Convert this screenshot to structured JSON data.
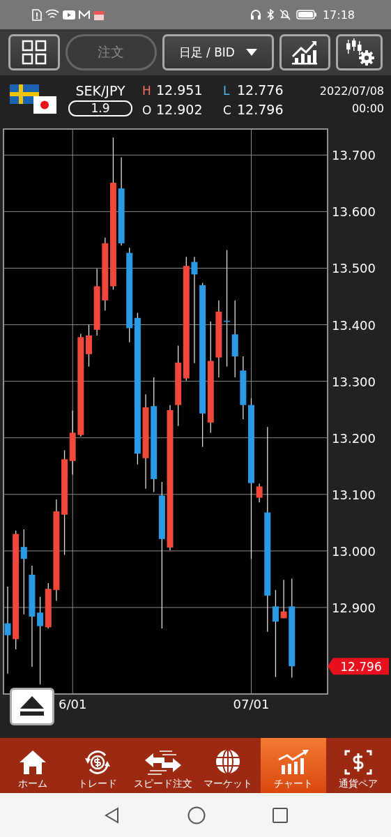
{
  "status_bar": {
    "time": "17:18"
  },
  "toolbar": {
    "order_button": {
      "label": "注文",
      "disabled": true
    },
    "timeframe": {
      "label": "日足 / BID"
    }
  },
  "quote": {
    "pair": "SEK/JPY",
    "spread": "1.9",
    "high_label": "H",
    "high": "12.951",
    "low_label": "L",
    "low": "12.776",
    "open_label": "O",
    "open": "12.902",
    "close_label": "C",
    "close": "12.796",
    "date": "2022/07/08",
    "time": "00:00"
  },
  "chart": {
    "last_price": "12.796",
    "chart_data": {
      "type": "candlestick",
      "grid": true,
      "ylim": [
        12.747,
        13.746
      ],
      "yticks": [
        {
          "value": 12.9,
          "label": "12.900"
        },
        {
          "value": 13.0,
          "label": "13.000"
        },
        {
          "value": 13.1,
          "label": "13.100"
        },
        {
          "value": 13.2,
          "label": "13.200"
        },
        {
          "value": 13.3,
          "label": "13.300"
        },
        {
          "value": 13.4,
          "label": "13.400"
        },
        {
          "value": 13.5,
          "label": "13.500"
        },
        {
          "value": 13.6,
          "label": "13.600"
        },
        {
          "value": 13.7,
          "label": "13.700"
        }
      ],
      "categories": [
        null,
        null,
        null,
        null,
        null,
        null,
        null,
        null,
        "6/01",
        null,
        null,
        null,
        null,
        null,
        null,
        null,
        null,
        null,
        null,
        null,
        null,
        null,
        null,
        null,
        null,
        null,
        null,
        null,
        null,
        null,
        "07/01",
        null,
        null,
        null,
        null,
        null
      ],
      "ohlc": [
        [
          12.872,
          12.937,
          12.783,
          12.851
        ],
        [
          12.844,
          13.036,
          12.826,
          13.03
        ],
        [
          13.007,
          13.038,
          12.888,
          12.986
        ],
        [
          12.958,
          12.974,
          12.795,
          12.884
        ],
        [
          12.891,
          12.919,
          12.764,
          12.867
        ],
        [
          12.865,
          12.943,
          12.863,
          12.933
        ],
        [
          12.931,
          13.091,
          12.912,
          13.07
        ],
        [
          13.064,
          13.178,
          12.993,
          13.162
        ],
        [
          13.159,
          13.248,
          13.135,
          13.209
        ],
        [
          13.205,
          13.384,
          13.202,
          13.378
        ],
        [
          13.348,
          13.4,
          13.326,
          13.381
        ],
        [
          13.391,
          13.499,
          13.381,
          13.468
        ],
        [
          13.443,
          13.554,
          13.425,
          13.544
        ],
        [
          13.468,
          13.731,
          13.462,
          13.651
        ],
        [
          13.641,
          13.696,
          13.54,
          13.544
        ],
        [
          13.527,
          13.536,
          13.369,
          13.394
        ],
        [
          13.412,
          13.421,
          13.153,
          13.172
        ],
        [
          13.164,
          13.277,
          13.11,
          13.254
        ],
        [
          13.256,
          13.307,
          13.104,
          13.127
        ],
        [
          13.098,
          13.122,
          12.863,
          13.021
        ],
        [
          13.006,
          13.258,
          13.001,
          13.249
        ],
        [
          13.258,
          13.363,
          13.221,
          13.333
        ],
        [
          13.305,
          13.52,
          13.301,
          13.504
        ],
        [
          13.511,
          13.52,
          13.332,
          13.489
        ],
        [
          13.47,
          13.474,
          13.184,
          13.243
        ],
        [
          13.227,
          13.406,
          13.209,
          13.336
        ],
        [
          13.342,
          13.443,
          13.307,
          13.423
        ],
        [
          13.407,
          13.532,
          13.326,
          13.406
        ],
        [
          13.383,
          13.443,
          13.307,
          13.344
        ],
        [
          13.319,
          13.344,
          13.233,
          13.258
        ],
        [
          13.258,
          13.27,
          12.986,
          13.12
        ],
        [
          13.094,
          13.119,
          13.086,
          13.114
        ],
        [
          13.068,
          13.219,
          12.857,
          12.921
        ],
        [
          12.902,
          12.931,
          12.777,
          12.875
        ],
        [
          12.881,
          12.949,
          12.881,
          12.893
        ],
        [
          12.902,
          12.951,
          12.776,
          12.796
        ]
      ]
    }
  },
  "nav": [
    {
      "label": "ホーム",
      "selected": false
    },
    {
      "label": "トレード",
      "selected": false
    },
    {
      "label": "スピード注文",
      "selected": false
    },
    {
      "label": "マーケット",
      "selected": false
    },
    {
      "label": "チャート",
      "selected": true
    },
    {
      "label": "通貨ペア",
      "selected": false
    }
  ]
}
